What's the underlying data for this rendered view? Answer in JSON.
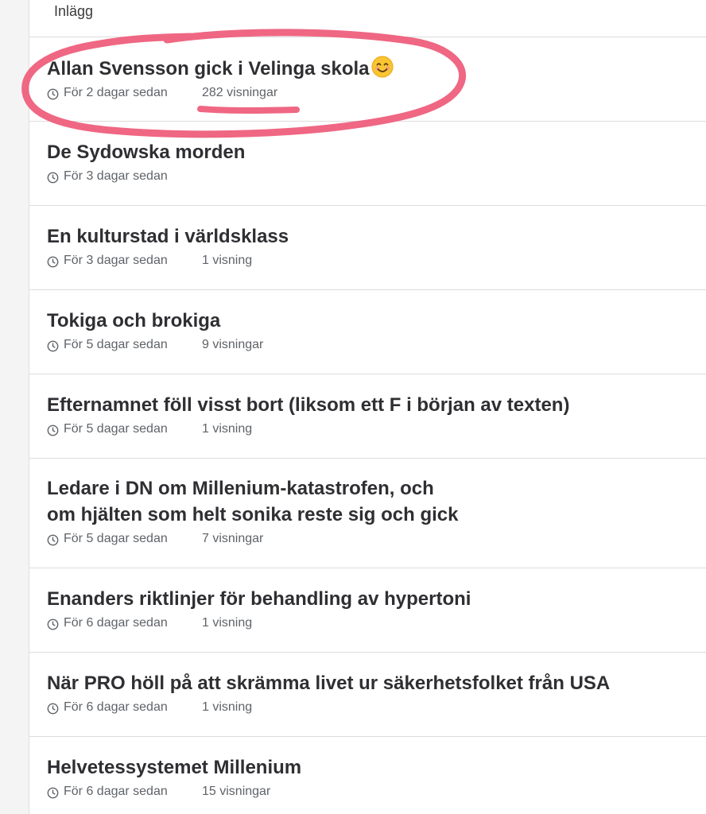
{
  "header": {
    "label": "Inlägg"
  },
  "posts": [
    {
      "title": "Allan Svensson gick i Velinga skola",
      "date": "För 2 dagar sedan",
      "views": "282 visningar"
    },
    {
      "title": "De Sydowska morden",
      "date": "För 3 dagar sedan",
      "views": ""
    },
    {
      "title": "En kulturstad i världsklass",
      "date": "För 3 dagar sedan",
      "views": "1 visning"
    },
    {
      "title": "Tokiga och brokiga",
      "date": "För 5 dagar sedan",
      "views": "9 visningar"
    },
    {
      "title": "Efternamnet föll visst bort (liksom ett F i början av texten)",
      "date": "För 5 dagar sedan",
      "views": "1 visning"
    },
    {
      "title_line1": "Ledare i DN om Millenium-katastrofen, och",
      "title_line2": "om hjälten som helt sonika reste sig och gick",
      "date": "För 5 dagar sedan",
      "views": "7 visningar"
    },
    {
      "title": "Enanders riktlinjer för behandling av hypertoni",
      "date": "För 6 dagar sedan",
      "views": "1 visning"
    },
    {
      "title": "När PRO höll på att skrämma livet ur säkerhetsfolket från USA",
      "date": "För 6 dagar sedan",
      "views": "1 visning"
    },
    {
      "title": "Helvetessystemet Millenium",
      "date": "För 6 dagar sedan",
      "views": "15 visningar"
    }
  ],
  "icons": {
    "clock": "clock-icon",
    "emoji": "smiling-face-emoji-icon"
  },
  "colors": {
    "title": "#2f2f33",
    "meta": "#5f6368",
    "divider": "#dcdcdc",
    "annotation": "#ee5a78"
  }
}
